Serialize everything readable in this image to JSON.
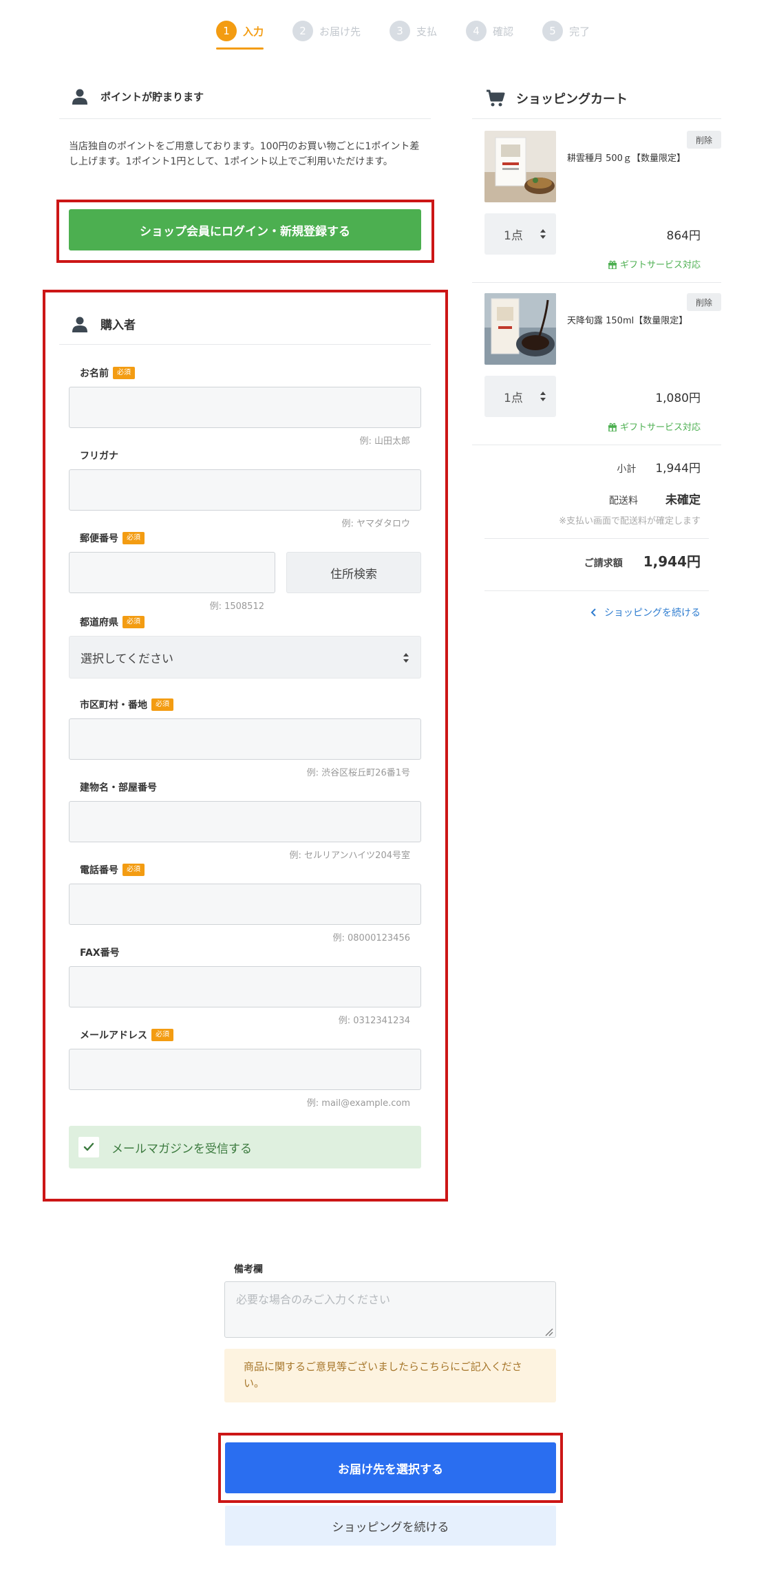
{
  "steps": [
    {
      "num": "1",
      "label": "入力"
    },
    {
      "num": "2",
      "label": "お届け先"
    },
    {
      "num": "3",
      "label": "支払"
    },
    {
      "num": "4",
      "label": "確認"
    },
    {
      "num": "5",
      "label": "完了"
    }
  ],
  "points": {
    "title": "ポイントが貯まります",
    "description": "当店独自のポイントをご用意しております。100円のお買い物ごとに1ポイント差し上げます。1ポイント1円として、1ポイント以上でご利用いただけます。",
    "login_button": "ショップ会員にログイン・新規登録する"
  },
  "buyer": {
    "title": "購入者",
    "required_badge": "必須",
    "name_label": "お名前",
    "name_hint": "例: 山田太郎",
    "kana_label": "フリガナ",
    "kana_hint": "例: ヤマダタロウ",
    "zip_label": "郵便番号",
    "zip_hint": "例: 1508512",
    "zip_search_button": "住所検索",
    "pref_label": "都道府県",
    "pref_selected": "選択してください",
    "city_label": "市区町村・番地",
    "city_hint": "例: 渋谷区桜丘町26番1号",
    "building_label": "建物名・部屋番号",
    "building_hint": "例: セルリアンハイツ204号室",
    "tel_label": "電話番号",
    "tel_hint": "例: 08000123456",
    "fax_label": "FAX番号",
    "fax_hint": "例: 0312341234",
    "email_label": "メールアドレス",
    "email_hint": "例: mail@example.com",
    "magazine_label": "メールマガジンを受信する"
  },
  "cart": {
    "title": "ショッピングカート",
    "delete_label": "削除",
    "gift_label": "ギフトサービス対応",
    "items": [
      {
        "name": "耕雲種月 500ｇ【数量限定】",
        "qty": "1点",
        "price": "864円"
      },
      {
        "name": "天降旬露 150ml【数量限定】",
        "qty": "1点",
        "price": "1,080円"
      }
    ],
    "subtotal_label": "小計",
    "subtotal_value": "1,944円",
    "shipping_label": "配送料",
    "shipping_value": "未確定",
    "shipping_note": "※支払い画面で配送料が確定します",
    "total_label": "ご請求額",
    "total_value": "1,944円",
    "continue_link": "ショッピングを続ける"
  },
  "memo": {
    "label": "備考欄",
    "placeholder": "必要な場合のみご入力ください",
    "info": "商品に関するご意見等ございましたらこちらにご記入ください。"
  },
  "actions": {
    "next_button": "お届け先を選択する",
    "continue_button": "ショッピングを続ける"
  },
  "colors": {
    "accent": "#f39c12",
    "login_green": "#4caf50",
    "primary_blue": "#2a6ef0",
    "highlight_red": "#cc1616"
  }
}
